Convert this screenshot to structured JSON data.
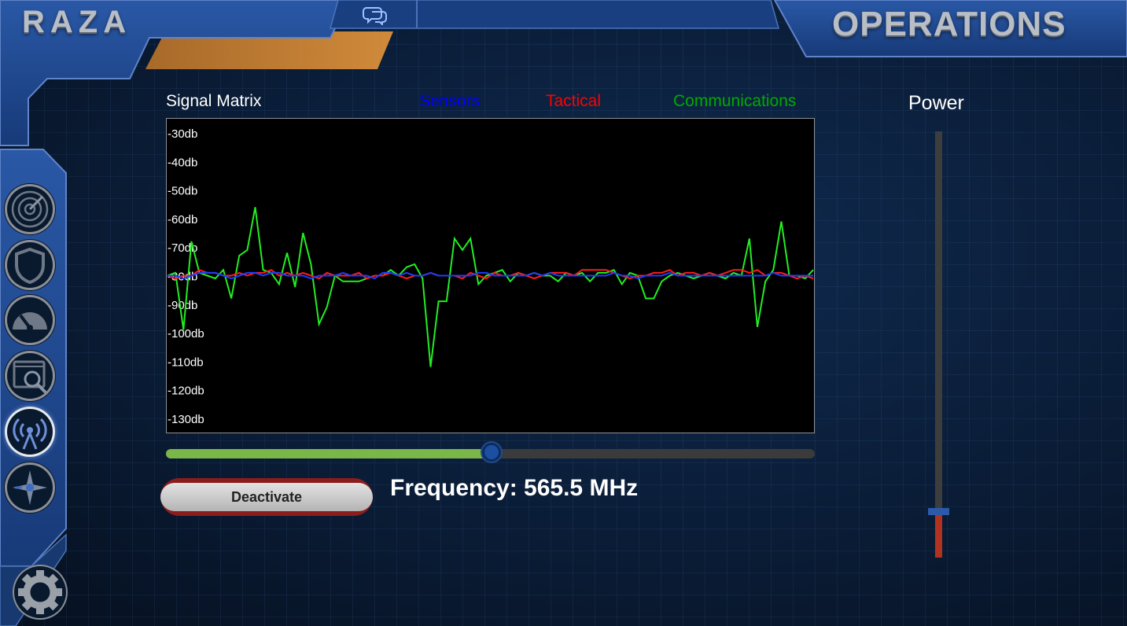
{
  "brand": "RAZA",
  "page_title": "OPERATIONS",
  "header": {
    "chat_icon": "chat-bubbles-icon"
  },
  "sidebar": {
    "items": [
      {
        "name": "radar",
        "icon": "radar-icon",
        "active": false
      },
      {
        "name": "shield",
        "icon": "shield-icon",
        "active": false
      },
      {
        "name": "gauge",
        "icon": "gauge-icon",
        "active": false
      },
      {
        "name": "scanner",
        "icon": "screen-search-icon",
        "active": false
      },
      {
        "name": "signal",
        "icon": "antenna-signal-icon",
        "active": true
      },
      {
        "name": "navigation",
        "icon": "compass-star-icon",
        "active": false
      }
    ],
    "settings_icon": "gear-icon"
  },
  "signal_panel": {
    "title": "Signal Matrix",
    "legend": [
      {
        "label": "Sensors",
        "color": "#0000ff"
      },
      {
        "label": "Tactical",
        "color": "#ff0000"
      },
      {
        "label": "Communications",
        "color": "#00aa00"
      }
    ]
  },
  "chart_data": {
    "type": "line",
    "title": "Signal Matrix",
    "y_ticks": [
      "-30db",
      "-40db",
      "-50db",
      "-60db",
      "-70db",
      "-80db",
      "-90db",
      "-100db",
      "-110db",
      "-120db",
      "-130db"
    ],
    "ylim": [
      -135,
      -25
    ],
    "x_count": 81,
    "grid": false,
    "series": [
      {
        "name": "Communications",
        "color": "#22ee22",
        "values": [
          -80,
          -79,
          -99,
          -68,
          -79,
          -80,
          -81,
          -78,
          -88,
          -73,
          -71,
          -56,
          -78,
          -79,
          -83,
          -72,
          -84,
          -65,
          -76,
          -97,
          -91,
          -80,
          -82,
          -82,
          -82,
          -81,
          -80,
          -80,
          -78,
          -80,
          -77,
          -76,
          -81,
          -112,
          -89,
          -89,
          -67,
          -71,
          -67,
          -83,
          -80,
          -79,
          -78,
          -82,
          -79,
          -80,
          -79,
          -80,
          -80,
          -82,
          -79,
          -80,
          -79,
          -82,
          -79,
          -79,
          -78,
          -83,
          -79,
          -80,
          -88,
          -88,
          -82,
          -80,
          -79,
          -80,
          -81,
          -80,
          -79,
          -80,
          -81,
          -79,
          -80,
          -67,
          -98,
          -82,
          -78,
          -61,
          -80,
          -80,
          -81,
          -78
        ]
      },
      {
        "name": "Tactical",
        "color": "#ff1a1a",
        "values": [
          -80,
          -81,
          -80,
          -80,
          -78,
          -79,
          -79,
          -80,
          -80,
          -79,
          -80,
          -79,
          -79,
          -78,
          -80,
          -79,
          -80,
          -79,
          -80,
          -81,
          -79,
          -80,
          -80,
          -80,
          -79,
          -81,
          -80,
          -80,
          -79,
          -80,
          -81,
          -80,
          -80,
          -79,
          -80,
          -80,
          -80,
          -81,
          -79,
          -80,
          -81,
          -79,
          -80,
          -80,
          -79,
          -80,
          -81,
          -80,
          -79,
          -79,
          -79,
          -80,
          -78,
          -78,
          -78,
          -78,
          -79,
          -80,
          -81,
          -80,
          -80,
          -79,
          -79,
          -78,
          -80,
          -79,
          -79,
          -80,
          -79,
          -80,
          -79,
          -78,
          -78,
          -79,
          -78,
          -80,
          -79,
          -79,
          -80,
          -81,
          -80,
          -81
        ]
      },
      {
        "name": "Sensors",
        "color": "#1e3cff",
        "values": [
          -80,
          -80,
          -81,
          -80,
          -79,
          -79,
          -79,
          -80,
          -81,
          -80,
          -79,
          -79,
          -80,
          -79,
          -79,
          -80,
          -80,
          -80,
          -81,
          -80,
          -80,
          -80,
          -79,
          -80,
          -80,
          -80,
          -81,
          -79,
          -79,
          -80,
          -79,
          -80,
          -80,
          -79,
          -80,
          -80,
          -80,
          -80,
          -80,
          -79,
          -79,
          -80,
          -80,
          -80,
          -80,
          -80,
          -79,
          -80,
          -79,
          -80,
          -80,
          -80,
          -80,
          -80,
          -80,
          -80,
          -79,
          -80,
          -80,
          -81,
          -80,
          -80,
          -80,
          -79,
          -80,
          -80,
          -80,
          -80,
          -80,
          -80,
          -80,
          -80,
          -80,
          -80,
          -80,
          -80,
          -79,
          -80,
          -80,
          -80,
          -80,
          -80
        ]
      }
    ]
  },
  "frequency": {
    "text": "Frequency: 565.5 MHz",
    "slider_fraction": 0.502
  },
  "deactivate_label": "Deactivate",
  "power": {
    "label": "Power",
    "level_fraction": 0.1
  },
  "colors": {
    "accent": "#1d4fa0",
    "brand_orange": "#c77a30",
    "slider_green": "#7ab648",
    "power_red": "#b23220"
  }
}
